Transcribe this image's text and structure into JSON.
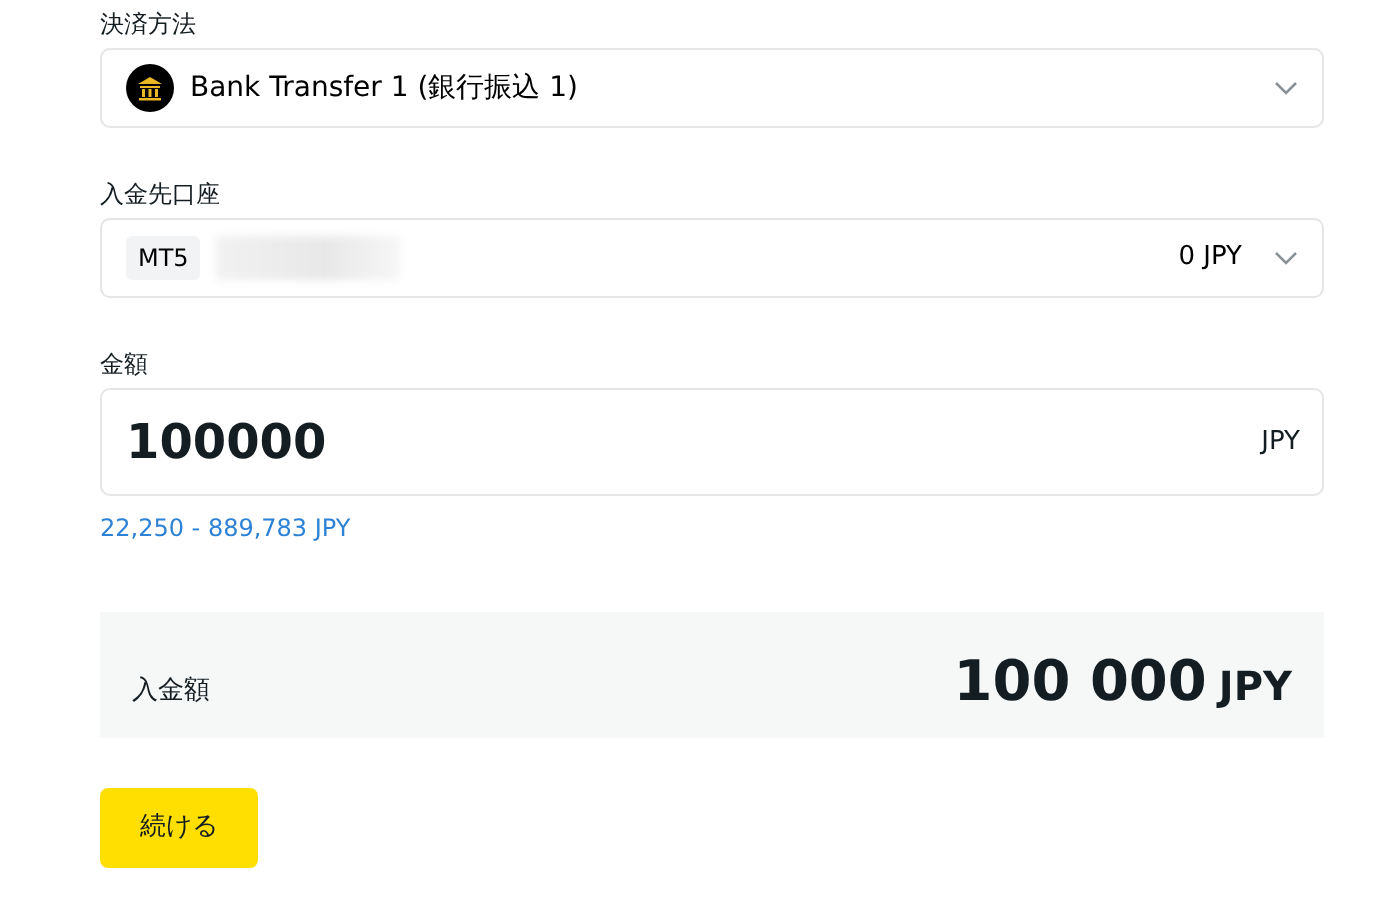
{
  "payment_method": {
    "label": "決済方法",
    "value": "Bank Transfer 1 (銀行振込 1)"
  },
  "account": {
    "label": "入金先口座",
    "platform": "MT5",
    "balance": "0 JPY"
  },
  "amount": {
    "label": "金額",
    "value": "100000",
    "currency": "JPY",
    "range": "22,250 - 889,783 JPY"
  },
  "summary": {
    "label": "入金額",
    "amount": "100 000",
    "currency": "JPY"
  },
  "button": {
    "label": "続ける"
  }
}
